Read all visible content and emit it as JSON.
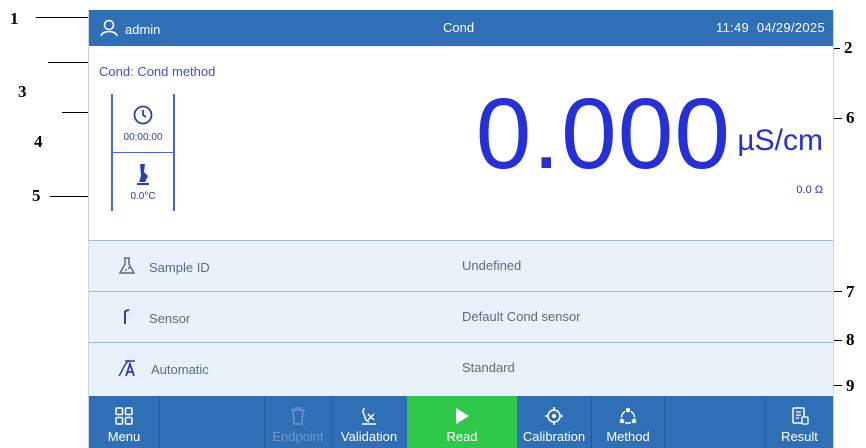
{
  "callouts": [
    "1",
    "2",
    "3",
    "4",
    "5",
    "6",
    "7",
    "8",
    "9"
  ],
  "topbar": {
    "user": "admin",
    "title": "Cond",
    "time": "11:49",
    "date": "04/29/2025"
  },
  "method_label": "Cond: Cond method",
  "status": {
    "timer": "00:00:00",
    "temperature": "0.0°C"
  },
  "reading": {
    "value": "0.000",
    "unit": "µS/cm",
    "resistance": "0.0 Ω"
  },
  "rows": [
    {
      "label": "Sample ID",
      "value": "Undefined",
      "icon": "flask-icon"
    },
    {
      "label": "Sensor",
      "value": "Default Cond sensor",
      "icon": "sensor-icon"
    },
    {
      "label": "Automatic",
      "value": "Standard",
      "icon": "auto-endpoint-icon"
    }
  ],
  "bottombar": {
    "menu": "Menu",
    "endpoint": "Endpoint",
    "validation": "Validation",
    "read": "Read",
    "calibration": "Calibration",
    "method": "Method",
    "result": "Result"
  },
  "colors": {
    "bar": "#2f6fb5",
    "read": "#2ec94a",
    "reading": "#2530d8",
    "row_bg": "#e9f2fb"
  }
}
